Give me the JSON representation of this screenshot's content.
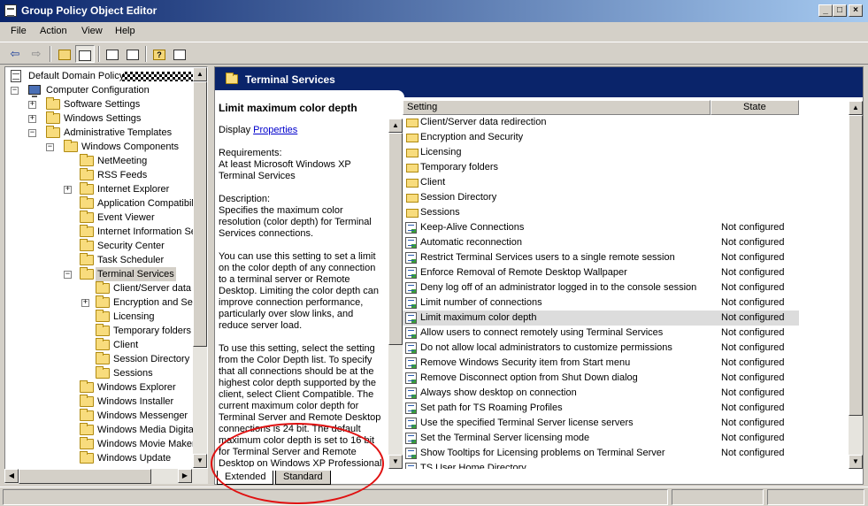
{
  "window": {
    "title": "Group Policy Object Editor"
  },
  "menu": {
    "file": "File",
    "action": "Action",
    "view": "View",
    "help": "Help"
  },
  "tree": {
    "root": "Default Domain Policy",
    "computer_configuration": "Computer Configuration",
    "software_settings": "Software Settings",
    "windows_settings": "Windows Settings",
    "administrative_templates": "Administrative Templates",
    "windows_components": "Windows Components",
    "netmeeting": "NetMeeting",
    "rss_feeds": "RSS Feeds",
    "internet_explorer": "Internet Explorer",
    "application_compatibility": "Application Compatibility",
    "event_viewer": "Event Viewer",
    "internet_information_services": "Internet Information Se",
    "security_center": "Security Center",
    "task_scheduler": "Task Scheduler",
    "terminal_services": "Terminal Services",
    "client_server_data": "Client/Server data r",
    "encryption_security": "Encryption and Secu",
    "licensing": "Licensing",
    "temporary_folders": "Temporary folders",
    "client": "Client",
    "session_directory": "Session Directory",
    "sessions": "Sessions",
    "windows_explorer": "Windows Explorer",
    "windows_installer": "Windows Installer",
    "windows_messenger": "Windows Messenger",
    "windows_media_digital": "Windows Media Digital R",
    "windows_movie_maker": "Windows Movie Maker",
    "windows_update": "Windows Update"
  },
  "details": {
    "header": "Terminal Services",
    "setting_title": "Limit maximum color depth",
    "display_label": "Display",
    "properties_link": "Properties",
    "requirements_label": "Requirements:",
    "requirements_1": "At least Microsoft Windows XP",
    "requirements_2": "Terminal Services",
    "description_label": "Description:",
    "d1": "Specifies the maximum color",
    "d2": "resolution (color depth) for Terminal",
    "d3": "Services connections.",
    "d4": "You can use this setting to set a limit",
    "d5": "on the color depth of any connection",
    "d6": "to a terminal server or Remote",
    "d7": "Desktop. Limiting the color depth can",
    "d8": "improve connection performance,",
    "d9": "particularly over slow links, and",
    "d10": "reduce server load.",
    "d11": "To use this setting, select the setting",
    "d12": "from the Color Depth list. To specify",
    "d13": "that all connections should be at the",
    "d14": "highest color depth supported by the",
    "d15": "client, select Client Compatible. The",
    "d16": "current maximum color depth for",
    "d17": "Terminal Server and Remote Desktop",
    "d18": "connections is 24 bit. The default",
    "d19": "maximum color depth is set to 16 bit",
    "d20": "for Terminal Server and Remote",
    "d21": "Desktop on Windows XP Professional"
  },
  "columns": {
    "setting": "Setting",
    "state": "State"
  },
  "folders": [
    "Client/Server data redirection",
    "Encryption and Security",
    "Licensing",
    "Temporary folders",
    "Client",
    "Session Directory",
    "Sessions"
  ],
  "settings": [
    {
      "name": "Keep-Alive Connections",
      "state": "Not configured"
    },
    {
      "name": "Automatic reconnection",
      "state": "Not configured"
    },
    {
      "name": "Restrict Terminal Services users to a single remote session",
      "state": "Not configured"
    },
    {
      "name": "Enforce Removal of Remote Desktop Wallpaper",
      "state": "Not configured"
    },
    {
      "name": "Deny log off of an administrator logged in to the console session",
      "state": "Not configured"
    },
    {
      "name": "Limit number of connections",
      "state": "Not configured"
    },
    {
      "name": "Limit maximum color depth",
      "state": "Not configured"
    },
    {
      "name": "Allow users to connect remotely using Terminal Services",
      "state": "Not configured"
    },
    {
      "name": "Do not allow local administrators to customize permissions",
      "state": "Not configured"
    },
    {
      "name": "Remove Windows Security item from Start menu",
      "state": "Not configured"
    },
    {
      "name": "Remove Disconnect option from Shut Down dialog",
      "state": "Not configured"
    },
    {
      "name": "Always show desktop on connection",
      "state": "Not configured"
    },
    {
      "name": "Set path for TS Roaming Profiles",
      "state": "Not configured"
    },
    {
      "name": "Use the specified Terminal Server license servers",
      "state": "Not configured"
    },
    {
      "name": "Set the Terminal Server licensing mode",
      "state": "Not configured"
    },
    {
      "name": "Show Tooltips for Licensing problems on Terminal Server",
      "state": "Not configured"
    },
    {
      "name": "TS User Home Directory",
      "state": ""
    }
  ],
  "tabs": {
    "extended": "Extended",
    "standard": "Standard"
  }
}
